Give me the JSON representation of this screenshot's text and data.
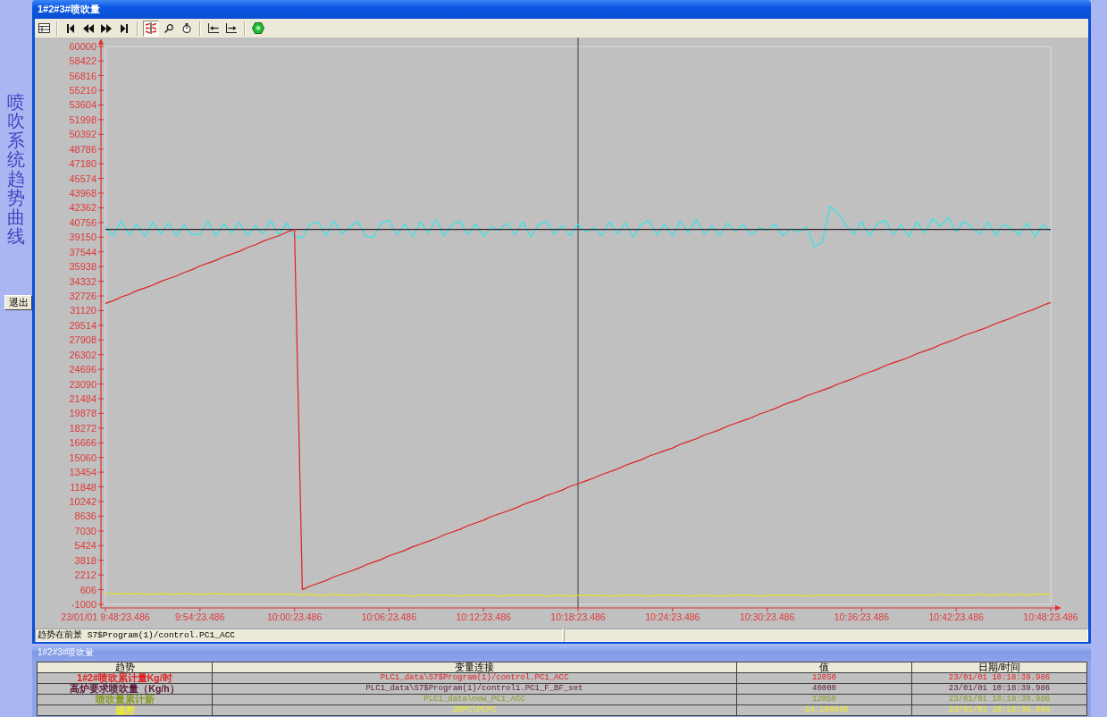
{
  "side_panel": {
    "title": "喷吹系统趋势曲线",
    "exit_button": "退出"
  },
  "trend_window": {
    "title": "1#2#3#喷吹量",
    "toolbar": [
      {
        "buttons": [
          {
            "kind": "table",
            "pressed": false
          }
        ]
      },
      {
        "buttons": [
          {
            "kind": "first",
            "pressed": false
          },
          {
            "kind": "rewind",
            "pressed": false
          },
          {
            "kind": "forward",
            "pressed": false
          },
          {
            "kind": "last",
            "pressed": false
          }
        ]
      },
      {
        "buttons": [
          {
            "kind": "trend",
            "pressed": true
          },
          {
            "kind": "zoom",
            "pressed": false
          },
          {
            "kind": "timer",
            "pressed": false
          }
        ]
      },
      {
        "buttons": [
          {
            "kind": "leftbar",
            "pressed": false
          },
          {
            "kind": "rightbar",
            "pressed": false
          }
        ]
      },
      {
        "buttons": [
          {
            "kind": "go",
            "pressed": false
          }
        ]
      }
    ],
    "chart_data": {
      "type": "line",
      "categories": [
        "23/01/01 9:48:23.486",
        null,
        null,
        null,
        null,
        null,
        null,
        null,
        null,
        null,
        null,
        null,
        "9:54:23.486",
        null,
        null,
        null,
        null,
        null,
        null,
        null,
        null,
        null,
        null,
        null,
        "10:00:23.486",
        null,
        null,
        null,
        null,
        null,
        null,
        null,
        null,
        null,
        null,
        null,
        "10:06:23.486",
        null,
        null,
        null,
        null,
        null,
        null,
        null,
        null,
        null,
        null,
        null,
        "10:12:23.486",
        null,
        null,
        null,
        null,
        null,
        null,
        null,
        null,
        null,
        null,
        null,
        "10:18:23.486",
        null,
        null,
        null,
        null,
        null,
        null,
        null,
        null,
        null,
        null,
        null,
        "10:24:23.486",
        null,
        null,
        null,
        null,
        null,
        null,
        null,
        null,
        null,
        null,
        null,
        "10:30:23.486",
        null,
        null,
        null,
        null,
        null,
        null,
        null,
        null,
        null,
        null,
        null,
        "10:36:23.486",
        null,
        null,
        null,
        null,
        null,
        null,
        null,
        null,
        null,
        null,
        null,
        "10:42:23.486",
        null,
        null,
        null,
        null,
        null,
        null,
        null,
        null,
        null,
        null,
        null,
        "10:48:23.486"
      ],
      "ylim": [
        -1000,
        60000
      ],
      "yticks": [
        60000,
        58422,
        56816,
        55210,
        53604,
        51998,
        50392,
        48786,
        47180,
        45574,
        43968,
        42362,
        40756,
        39150,
        37544,
        35938,
        34332,
        32726,
        31120,
        29514,
        27908,
        26302,
        24696,
        23090,
        21484,
        19878,
        18272,
        16666,
        15060,
        13454,
        11848,
        10242,
        8636,
        7030,
        5424,
        3818,
        2212,
        606,
        -1000
      ],
      "series": [
        {
          "color": "#e02020",
          "values": [
            31900,
            32200,
            32600,
            32900,
            33300,
            33600,
            33900,
            34300,
            34600,
            34900,
            35300,
            35600,
            36000,
            36300,
            36600,
            37000,
            37300,
            37600,
            38000,
            38300,
            38700,
            39000,
            39300,
            39700,
            40000,
            600,
            1000,
            1300,
            1600,
            2000,
            2300,
            2600,
            2900,
            3300,
            3600,
            3900,
            4300,
            4600,
            4900,
            5300,
            5600,
            5900,
            6200,
            6600,
            6900,
            7200,
            7600,
            7900,
            8200,
            8600,
            8900,
            9200,
            9500,
            9900,
            10200,
            10500,
            10900,
            11200,
            11500,
            11900,
            12200,
            12500,
            12800,
            13200,
            13500,
            13800,
            14200,
            14500,
            14800,
            15200,
            15500,
            15800,
            16100,
            16500,
            16800,
            17100,
            17500,
            17800,
            18100,
            18500,
            18800,
            19100,
            19400,
            19800,
            20100,
            20400,
            20800,
            21100,
            21400,
            21800,
            22100,
            22400,
            22700,
            23100,
            23400,
            23700,
            24100,
            24400,
            24700,
            25100,
            25400,
            25700,
            26000,
            26400,
            26700,
            27000,
            27400,
            27700,
            28000,
            28400,
            28700,
            29000,
            29300,
            29700,
            30000,
            30300,
            30700,
            31000,
            31300,
            31700,
            32000
          ]
        },
        {
          "color": "#302028",
          "values": [
            40000,
            40000,
            40000,
            40000,
            40000,
            40000,
            40000,
            40000,
            40000,
            40000,
            40000,
            40000,
            40000,
            40000,
            40000,
            40000,
            40000,
            40000,
            40000,
            40000,
            40000,
            40000,
            40000,
            40000,
            40000,
            40000,
            40000,
            40000,
            40000,
            40000,
            40000,
            40000,
            40000,
            40000,
            40000,
            40000,
            40000,
            40000,
            40000,
            40000,
            40000,
            40000,
            40000,
            40000,
            40000,
            40000,
            40000,
            40000,
            40000,
            40000,
            40000,
            40000,
            40000,
            40000,
            40000,
            40000,
            40000,
            40000,
            40000,
            40000,
            40000,
            40000,
            40000,
            40000,
            40000,
            40000,
            40000,
            40000,
            40000,
            40000,
            40000,
            40000,
            40000,
            40000,
            40000,
            40000,
            40000,
            40000,
            40000,
            40000,
            40000,
            40000,
            40000,
            40000,
            40000,
            40000,
            40000,
            40000,
            40000,
            40000,
            40000,
            40000,
            40000,
            40000,
            40000,
            40000,
            40000,
            40000,
            40000,
            40000,
            40000,
            40000,
            40000,
            40000,
            40000,
            40000,
            40000,
            40000,
            40000,
            40000,
            40000,
            40000,
            40000,
            40000,
            40000,
            40000,
            40000,
            40000,
            40000,
            40000,
            40000
          ]
        },
        {
          "color": "#e8e020",
          "values": [
            200,
            100,
            200,
            100,
            200,
            100,
            100,
            200,
            100,
            100,
            200,
            100,
            100,
            100,
            200,
            100,
            100,
            100,
            100,
            100,
            100,
            100,
            100,
            100,
            100,
            0,
            100,
            0,
            0,
            100,
            0,
            0,
            0,
            100,
            0,
            0,
            0,
            0,
            0,
            -100,
            0,
            0,
            0,
            0,
            0,
            -100,
            0,
            0,
            0,
            0,
            -100,
            0,
            0,
            0,
            0,
            0,
            -100,
            0,
            0,
            -100,
            0,
            0,
            0,
            0,
            -100,
            0,
            0,
            0,
            0,
            -100,
            0,
            0,
            0,
            0,
            -100,
            0,
            0,
            0,
            -100,
            0,
            0,
            0,
            0,
            -100,
            0,
            0,
            0,
            0,
            0,
            -100,
            0,
            0,
            0,
            0,
            0,
            0,
            0,
            0,
            0,
            0,
            0,
            0,
            0,
            0,
            0,
            0,
            100,
            0,
            0,
            0,
            0,
            100,
            0,
            0,
            100,
            0,
            100,
            0,
            100,
            100,
            100
          ]
        },
        {
          "color": "#30e4e8",
          "values": [
            40300,
            39300,
            40900,
            39400,
            40600,
            39200,
            40800,
            39500,
            40700,
            39300,
            40500,
            39400,
            39500,
            40900,
            39300,
            40600,
            39600,
            40800,
            39300,
            40400,
            39500,
            41000,
            39400,
            40700,
            39200,
            39100,
            40600,
            40800,
            39300,
            40900,
            39500,
            40200,
            40900,
            39300,
            39100,
            40700,
            41000,
            39400,
            40600,
            39200,
            40800,
            39600,
            41100,
            39300,
            40500,
            40900,
            39400,
            40600,
            39200,
            40300,
            39900,
            40700,
            39400,
            40800,
            39200,
            40500,
            40900,
            39500,
            40400,
            39300,
            40600,
            39700,
            40200,
            39300,
            40800,
            39500,
            40700,
            39200,
            40500,
            41000,
            39400,
            40600,
            39300,
            40900,
            39600,
            41100,
            39500,
            40400,
            39300,
            40700,
            39800,
            40500,
            39400,
            40200,
            39900,
            40600,
            39300,
            40100,
            39700,
            40300,
            38100,
            38600,
            42500,
            41800,
            40400,
            39500,
            40800,
            39300,
            40600,
            41000,
            39400,
            40500,
            39200,
            40800,
            39600,
            41200,
            40300,
            41300,
            39700,
            40900,
            40200,
            39500,
            40800,
            39300,
            40600,
            40100,
            39400,
            40700,
            39200,
            40500,
            39800
          ]
        }
      ],
      "ref_lines": [
        {
          "axis": "x",
          "value": "10:18:23.486"
        }
      ]
    },
    "status_bar": {
      "text": "趋势在前景 S7$Program(1)/control.PC1_ACC"
    }
  },
  "table_window": {
    "title": "1#2#3#喷吹量",
    "columns": [
      "趋势",
      "变量连接",
      "值",
      "日期/时间"
    ],
    "rows": [
      {
        "color": "#e02020",
        "cells": [
          "1#2#喷吹累计量Kg/时",
          "PLC1_data\\S7$Program(1)/control.PC1_ACC",
          "12050",
          "23/01/01 10:18:39.986"
        ]
      },
      {
        "color": "#5a1838",
        "cells": [
          "高炉要求喷吹量（Kg/h）",
          "PLC1_data\\S7$Program(1)/control1.PC1_F_BF_set",
          "40000",
          "23/01/01 10:18:39.986"
        ]
      },
      {
        "color": "#8a9a20",
        "cells": [
          "喷吹量累计新",
          "PLC1_data\\new_PC1_ACC",
          "12050",
          "23/01/01 10:18:39.986"
        ]
      },
      {
        "color": "#f0f020",
        "cells": [
          "偏差",
          "ZHPC\\PCPC",
          "-24.190430",
          "23/01/01 10:18:36.986"
        ]
      }
    ]
  }
}
